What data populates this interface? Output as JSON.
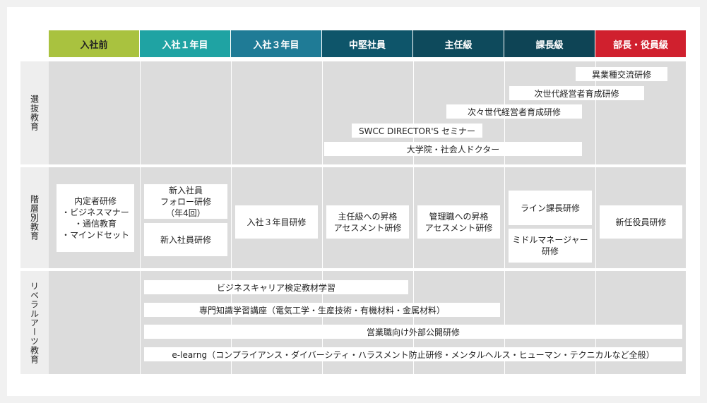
{
  "headers": [
    {
      "label": "入社前",
      "color": "#a9c23f"
    },
    {
      "label": "入社１年目",
      "color": "#1fa3a3"
    },
    {
      "label": "入社３年目",
      "color": "#1f7b96"
    },
    {
      "label": "中堅社員",
      "color": "#0e556a"
    },
    {
      "label": "主任級",
      "color": "#0e4a5c"
    },
    {
      "label": "課長級",
      "color": "#0e4455"
    },
    {
      "label": "部長・役員級",
      "color": "#d0202e"
    }
  ],
  "rows": {
    "selection": "選抜教育",
    "hierarchy": "階層別教育",
    "liberal": "リベラルアーツ教育"
  },
  "selection": {
    "cross_industry": "異業種交流研修",
    "next_gen": "次世代経営者育成研修",
    "next_next_gen": "次々世代経営者育成研修",
    "director_seminar": "SWCC DIRECTOR'S セミナー",
    "doctorate": "大学院・社会人ドクター"
  },
  "hierarchy": {
    "prejoin": "内定者研修\n・ビジネスマナー\n・通信教育\n・マインドセット",
    "new_follow": "新入社員\nフォロー研修\n（年4回）",
    "new_employee": "新入社員研修",
    "third_year": "入社３年目研修",
    "chief_assess": "主任級への昇格\nアセスメント研修",
    "manager_assess": "管理職への昇格\nアセスメント研修",
    "line_manager": "ライン課長研修",
    "middle_manager": "ミドルマネージャー\n研修",
    "new_exec": "新任役員研修"
  },
  "liberal": {
    "career_exam": "ビジネスキャリア検定教材学習",
    "specialist": "専門知識学習講座（電気工学・生産技術・有機材料・金属材料）",
    "sales_open": "営業職向け外部公開研修",
    "elearning": "e-learng（コンプライアンス・ダイバーシティ・ハラスメント防止研修・メンタルヘルス・ヒューマン・テクニカルなど全般）"
  }
}
